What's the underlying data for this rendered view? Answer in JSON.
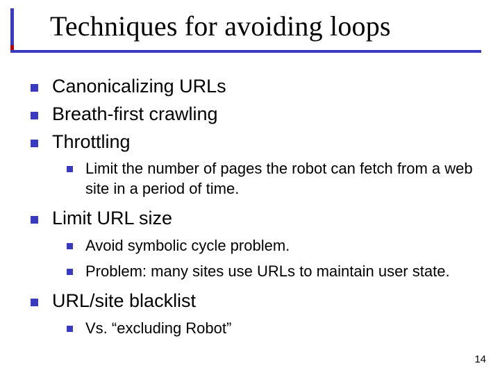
{
  "title": "Techniques for avoiding loops",
  "bullets": {
    "b1": "Canonicalizing URLs",
    "b2": "Breath-first crawling",
    "b3": "Throttling",
    "b3_1": "Limit the number of pages the robot can fetch from a web site in a period of time.",
    "b4": "Limit URL size",
    "b4_1": "Avoid symbolic cycle problem.",
    "b4_2": "Problem: many sites use URLs to maintain user state.",
    "b5": "URL/site blacklist",
    "b5_1": "Vs. “excluding Robot”"
  },
  "page_number": "14"
}
